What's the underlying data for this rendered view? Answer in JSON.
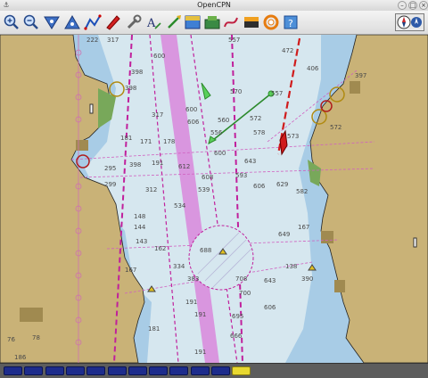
{
  "window": {
    "title": "OpenCPN"
  },
  "toolbar": {
    "buttons": [
      {
        "name": "zoom-in-icon"
      },
      {
        "name": "zoom-out-icon"
      },
      {
        "name": "scale-down-icon"
      },
      {
        "name": "scale-up-icon"
      },
      {
        "name": "route-icon"
      },
      {
        "name": "follow-ship-icon"
      },
      {
        "name": "settings-icon"
      },
      {
        "name": "text-icon"
      },
      {
        "name": "current-icon"
      },
      {
        "name": "tide-icon"
      },
      {
        "name": "print-icon"
      },
      {
        "name": "route-manager-icon"
      },
      {
        "name": "track-icon"
      },
      {
        "name": "colour-scheme-icon"
      },
      {
        "name": "mob-icon"
      },
      {
        "name": "help-icon"
      }
    ],
    "compass": {
      "name": "compass-icon"
    }
  },
  "chart": {
    "soundings": [
      "222",
      "317",
      "600",
      "398",
      "398",
      "317",
      "570",
      "557",
      "472",
      "406",
      "397",
      "600",
      "557",
      "606",
      "560",
      "572",
      "572",
      "578",
      "556",
      "573",
      "181",
      "171",
      "178",
      "295",
      "398",
      "299",
      "312",
      "191",
      "612",
      "600",
      "643",
      "608",
      "606",
      "629",
      "593",
      "534",
      "539",
      "582",
      "148",
      "144",
      "143",
      "162",
      "167",
      "688",
      "649",
      "167",
      "138",
      "334",
      "383",
      "708",
      "643",
      "700",
      "390",
      "191",
      "191",
      "695",
      "606",
      "666",
      "78",
      "186",
      "76",
      "191",
      "181"
    ],
    "chart_quilt": {
      "panels": 12,
      "active_panel": 11
    }
  }
}
